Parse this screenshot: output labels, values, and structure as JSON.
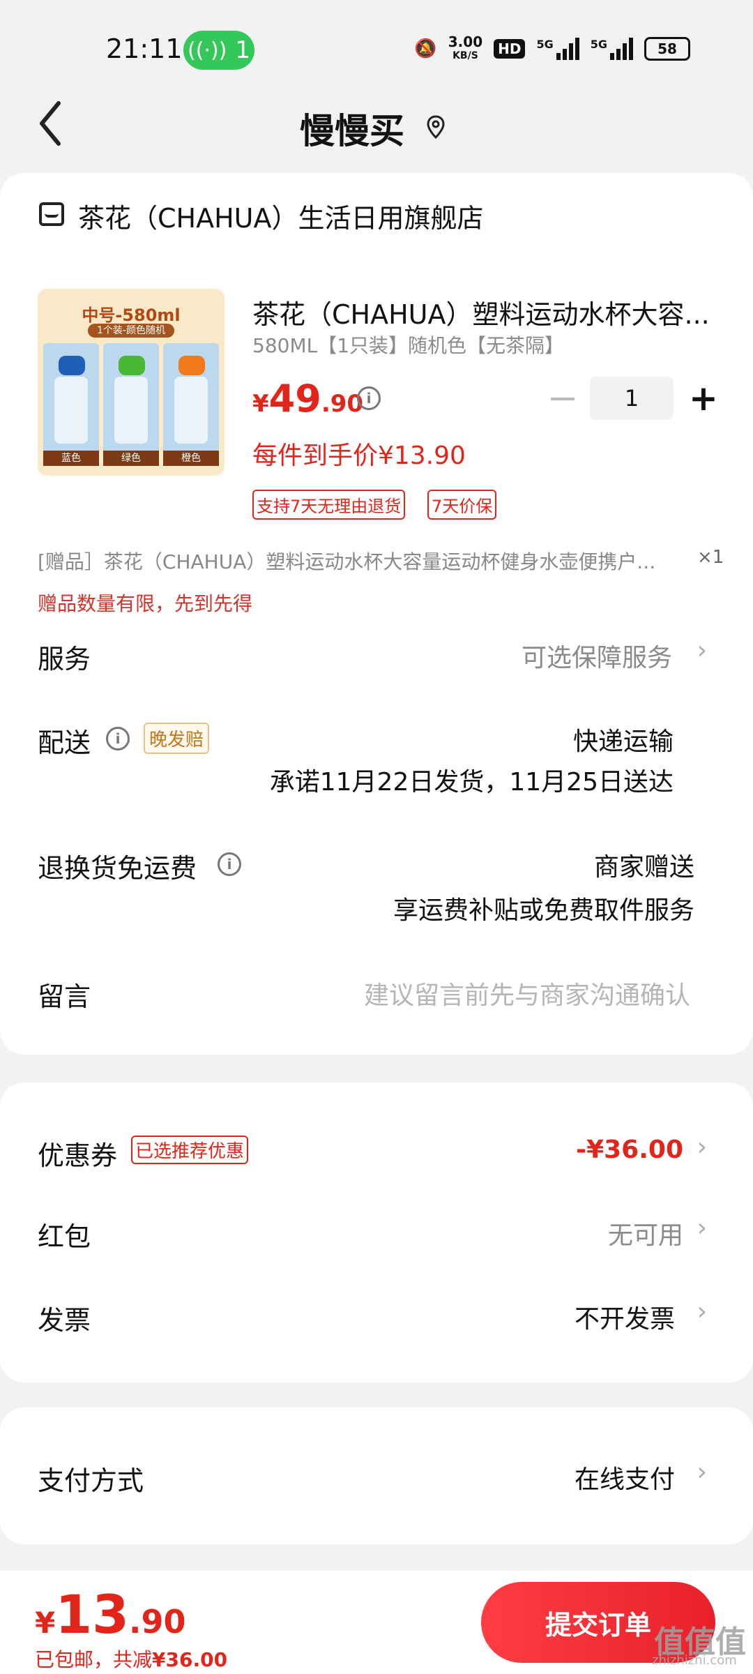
{
  "status_bar": {
    "time": "21:11",
    "hotspot_count": "1",
    "net_speed_value": "3.00",
    "net_speed_unit": "KB/S",
    "hd_label": "HD",
    "signal1_label": "5G",
    "signal2_label": "5G",
    "battery": "58"
  },
  "header": {
    "title": "慢慢买"
  },
  "store": {
    "name": "茶花（CHAHUA）生活日用旗舰店"
  },
  "product": {
    "image_tag": "中号-580ml",
    "image_sub": "1个装-颜色随机",
    "image_colors": [
      "蓝色",
      "绿色",
      "橙色"
    ],
    "title": "茶花（CHAHUA）塑料运动水杯大容...",
    "spec": "580ML【1只装】随机色【无茶隔】",
    "price_currency": "¥",
    "price_int": "49",
    "price_dec": ".90",
    "quantity": "1",
    "per_price": "每件到手价¥13.90",
    "badges": [
      "支持7天无理由退货",
      "7天价保"
    ]
  },
  "gift": {
    "line": "[赠品］茶花（CHAHUA）塑料运动水杯大容量运动杯健身水壶便携户...",
    "qty": "×1",
    "note": "赠品数量有限，先到先得"
  },
  "rows": {
    "service_label": "服务",
    "service_value": "可选保障服务",
    "delivery_label": "配送",
    "delivery_badge": "晚发赔",
    "delivery_method": "快递运输",
    "delivery_promise": "承诺11月22日发货，11月25日送达",
    "return_label": "退换货免运费",
    "return_value": "商家赠送",
    "return_desc": "享运费补贴或免费取件服务",
    "message_label": "留言",
    "message_placeholder": "建议留言前先与商家沟通确认"
  },
  "discounts": {
    "coupon_label": "优惠券",
    "coupon_badge": "已选推荐优惠",
    "coupon_value": "-¥36.00",
    "redpacket_label": "红包",
    "redpacket_value": "无可用",
    "invoice_label": "发票",
    "invoice_value": "不开发票"
  },
  "payment": {
    "label": "支付方式",
    "value": "在线支付"
  },
  "footer": {
    "currency": "¥",
    "total_int": "13",
    "total_dec": ".90",
    "summary_prefix": "已包邮，共减",
    "summary_save": "¥36.00",
    "submit_label": "提交订单",
    "watermark": "值值值",
    "watermark_sub": "zhizhizhi.com"
  },
  "colors": {
    "accent_red": "#e1251b",
    "hotspot_green": "#34c759",
    "background": "#f2f2f2"
  }
}
